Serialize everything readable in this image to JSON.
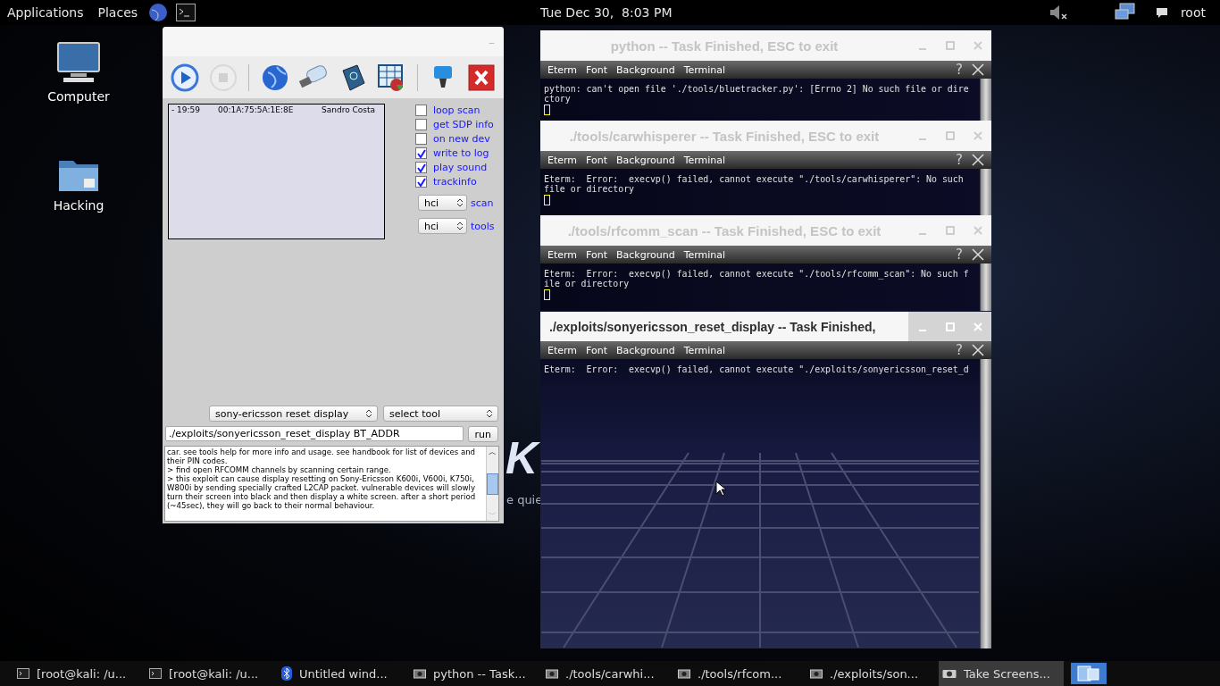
{
  "top_bar": {
    "menus": [
      "Applications",
      "Places"
    ],
    "clock": "Tue Dec 30,  8:03 PM",
    "user": "root"
  },
  "desktop_icons": [
    {
      "label": "Computer",
      "kind": "computer"
    },
    {
      "label": "Hacking",
      "kind": "folder"
    }
  ],
  "wallpaper": {
    "logo": "K",
    "tagline": "e quie"
  },
  "bluemaho": {
    "minimize": "–",
    "toolbar": [
      {
        "kind": "play",
        "disabled": false
      },
      {
        "kind": "stop",
        "disabled": true
      },
      {
        "kind": "globe",
        "disabled": false
      },
      {
        "kind": "usb",
        "disabled": false
      },
      {
        "kind": "book",
        "disabled": false
      },
      {
        "kind": "chart",
        "disabled": false
      },
      {
        "kind": "lamp",
        "disabled": false
      },
      {
        "kind": "exit",
        "disabled": false
      }
    ],
    "devices": [
      {
        "time": "- 19:59",
        "address": "00:1A:75:5A:1E:8E",
        "name": "Sandro Costa"
      }
    ],
    "options": [
      {
        "label": "loop scan",
        "checked": false
      },
      {
        "label": "get SDP info",
        "checked": false
      },
      {
        "label": "on new dev",
        "checked": false
      },
      {
        "label": "write to log",
        "checked": true
      },
      {
        "label": "play sound",
        "checked": true
      },
      {
        "label": "trackinfo",
        "checked": true
      }
    ],
    "adapters": [
      {
        "value": "hci",
        "label": "scan"
      },
      {
        "value": "hci",
        "label": "tools"
      }
    ],
    "exploit_select": "sony-ericsson reset display",
    "tool_select": "select tool",
    "command": "./exploits/sonyericsson_reset_display BT_ADDR",
    "run": "run",
    "scroll_up": "︿",
    "scroll_down": "﹀",
    "info": [
      "car. see tools help for more info and usage. see handbook for list of devices and their PIN codes.",
      "> find open RFCOMM channels by scanning certain range.",
      "> this exploit can cause display resetting on Sony-Ericsson K600i, V600i, K750i, W800i by sending specially crafted L2CAP packet. vulnerable devices will slowly turn their screen into black and then display a white screen. after a short period (~45sec), they will go back to their normal behaviour."
    ]
  },
  "terminals": [
    {
      "title": "python -- Task Finished, ESC to exit",
      "active": false,
      "menu": [
        "Eterm",
        "Font",
        "Background",
        "Terminal"
      ],
      "help": "?",
      "lines": [
        "python: can't open file './tools/bluetracker.py': [Errno 2] No such file or dire",
        "ctory"
      ],
      "cursor": true
    },
    {
      "title": "./tools/carwhisperer -- Task Finished, ESC to exit",
      "active": false,
      "menu": [
        "Eterm",
        "Font",
        "Background",
        "Terminal"
      ],
      "help": "?",
      "lines": [
        "Eterm:  Error:  execvp() failed, cannot execute \"./tools/carwhisperer\": No such",
        "file or directory"
      ],
      "cursor": true
    },
    {
      "title": "./tools/rfcomm_scan -- Task Finished, ESC to exit",
      "active": false,
      "menu": [
        "Eterm",
        "Font",
        "Background",
        "Terminal"
      ],
      "help": "?",
      "lines": [
        "Eterm:  Error:  execvp() failed, cannot execute \"./tools/rfcomm_scan\": No such f",
        "ile or directory"
      ],
      "cursor": true
    },
    {
      "title": "./exploits/sonyericsson_reset_display -- Task Finished,",
      "active": true,
      "menu": [
        "Eterm",
        "Font",
        "Background",
        "Terminal"
      ],
      "help": "?",
      "lines": [
        "Eterm:  Error:  execvp() failed, cannot execute \"./exploits/sonyericsson_reset_d"
      ],
      "cursor": false
    }
  ],
  "taskbar": [
    {
      "label": "[root@kali: /u...",
      "kind": "terminal",
      "selected": false
    },
    {
      "label": "[root@kali: /u...",
      "kind": "terminal",
      "selected": false
    },
    {
      "label": "Untitled wind...",
      "kind": "bluetooth",
      "selected": false
    },
    {
      "label": "python -- Task...",
      "kind": "eterm",
      "selected": false
    },
    {
      "label": "./tools/carwhi...",
      "kind": "eterm",
      "selected": false
    },
    {
      "label": "./tools/rfcom...",
      "kind": "eterm",
      "selected": false
    },
    {
      "label": "./exploits/son...",
      "kind": "eterm",
      "selected": false
    },
    {
      "label": "Take Screens...",
      "kind": "camera",
      "selected": true
    }
  ]
}
